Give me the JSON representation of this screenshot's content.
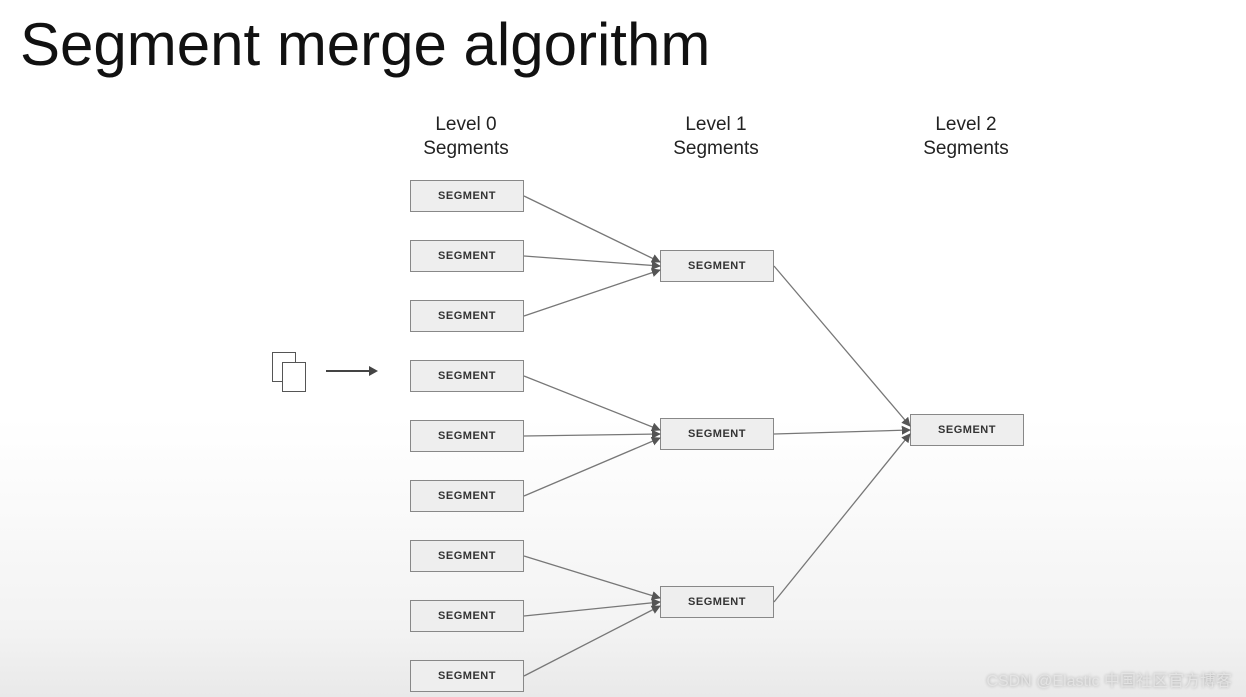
{
  "title": "Segment merge algorithm",
  "columns": {
    "level0": "Level 0\nSegments",
    "level1": "Level 1\nSegments",
    "level2": "Level 2\nSegments"
  },
  "box_label": "SEGMENT",
  "watermark": "CSDN @Elastic 中国社区官方博客",
  "diagram": {
    "description": "Documents flow into Level 0 segments. Groups of three Level 0 segments merge into one Level 1 segment. Three Level 1 segments merge into one Level 2 segment.",
    "levels": [
      {
        "name": "Level 0",
        "segment_count": 9,
        "merge_factor": 3
      },
      {
        "name": "Level 1",
        "segment_count": 3,
        "merge_factor": 3
      },
      {
        "name": "Level 2",
        "segment_count": 1
      }
    ]
  }
}
